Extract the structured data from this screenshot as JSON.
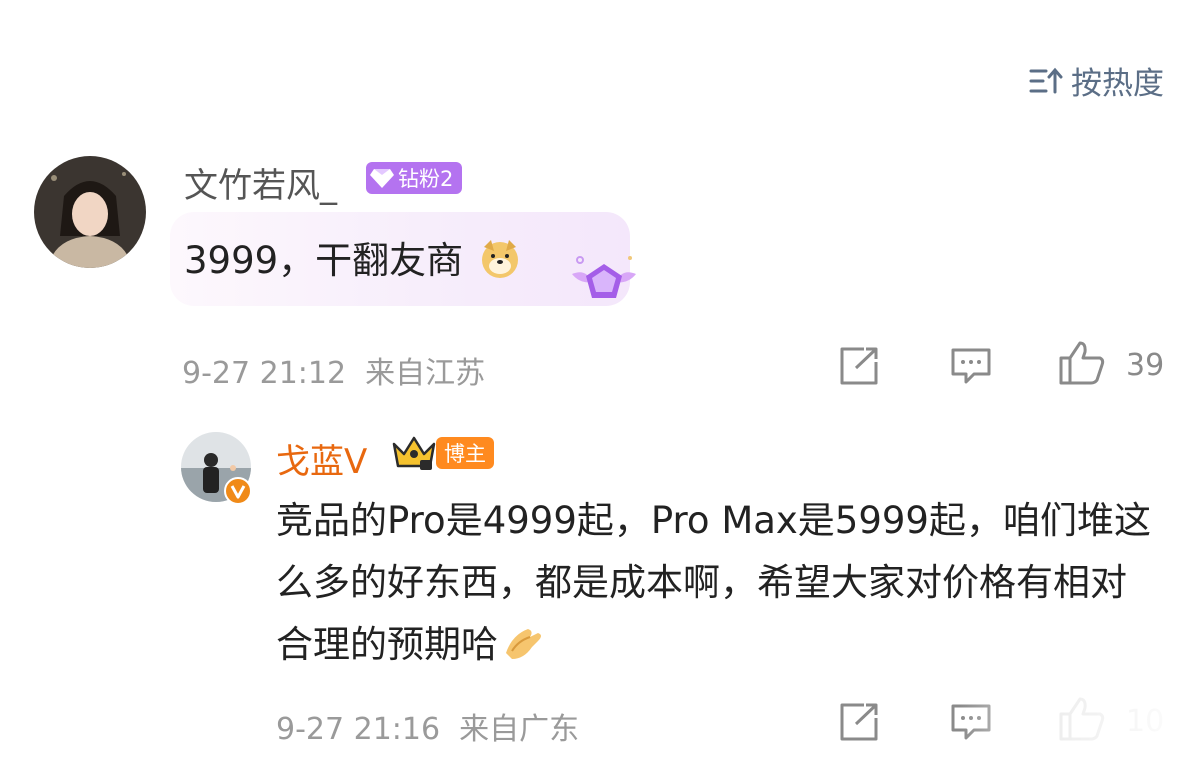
{
  "header": {
    "sort_label": "按热度",
    "sort_icon": "sort-icon"
  },
  "comment": {
    "username": "文竹若风_",
    "badge_label": "钻粉2",
    "text": "3999，干翻友商",
    "emoji": "doge-emoji",
    "meta": "9-27 21:12  来自江苏",
    "like_count": "39",
    "colors": {
      "username": "#555555",
      "badge": "#b473f0",
      "bubble": "#f5ecfb"
    }
  },
  "reply": {
    "username": "戈蓝V",
    "badge_label": "博主",
    "text": "竞品的Pro是4999起，Pro Max是5999起，咱们堆这么多的好东西，都是成本啊，希望大家对价格有相对合理的预期哈",
    "emoji": "clap-hands-emoji",
    "meta": "9-27 21:16  来自广东",
    "like_count": "10",
    "colors": {
      "username": "#e8680f",
      "badge": "#ff8a1f"
    }
  },
  "icons": {
    "repost": "repost-icon",
    "comment": "comment-icon",
    "like": "like-icon"
  }
}
